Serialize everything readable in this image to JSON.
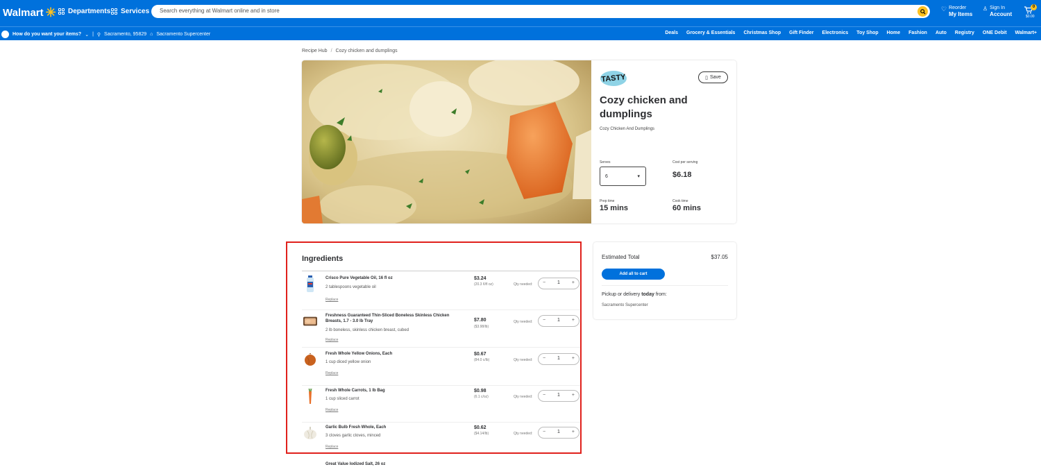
{
  "header": {
    "logo": "Walmart",
    "departments": "Departments",
    "services": "Services",
    "search_placeholder": "Search everything at Walmart online and in store",
    "reorder_top": "Reorder",
    "reorder_bottom": "My Items",
    "signin_top": "Sign In",
    "signin_bottom": "Account",
    "cart_count": "0",
    "cart_amount": "$0.00"
  },
  "subbar": {
    "how": "How do you want your items?",
    "zip": "Sacramento, 95829",
    "store": "Sacramento Supercenter",
    "nav": [
      "Deals",
      "Grocery & Essentials",
      "Christmas Shop",
      "Gift Finder",
      "Electronics",
      "Toy Shop",
      "Home",
      "Fashion",
      "Auto",
      "Registry",
      "ONE Debit",
      "Walmart+"
    ]
  },
  "breadcrumb": {
    "root": "Recipe Hub",
    "current": "Cozy chicken and dumplings"
  },
  "recipe": {
    "brand": "TASTY",
    "save": "Save",
    "title": "Cozy chicken and dumplings",
    "subtitle": "Cozy Chicken And Dumplings",
    "serves_label": "Serves",
    "serves_value": "6",
    "cost_label": "Cost per serving",
    "cost_value": "$6.18",
    "prep_label": "Prep time",
    "prep_value": "15 mins",
    "cook_label": "Cook time",
    "cook_value": "60 mins"
  },
  "ingredients": {
    "title": "Ingredients",
    "qty_label": "Qty needed:",
    "replace": "Replace",
    "items": [
      {
        "name": "Crisco Pure Vegetable Oil, 16 fl oz",
        "desc": "2 tablespoons vegetable oil",
        "price": "$3.24",
        "unit": "(20.3 ¢/fl oz)",
        "qty": "1",
        "icon": "oil-bottle-icon"
      },
      {
        "name": "Freshness Guaranteed Thin-Sliced Boneless Skinless Chicken Breasts, 1.7 - 3.0 lb Tray",
        "desc": "2 lb boneless, skinless chicken breast, cubed",
        "price": "$7.80",
        "unit": "($3.98/lb)",
        "qty": "1",
        "icon": "chicken-tray-icon"
      },
      {
        "name": "Fresh Whole Yellow Onions, Each",
        "desc": "1 cup diced yellow onion",
        "price": "$0.67",
        "unit": "(84.0 c/lb)",
        "qty": "1",
        "icon": "onion-icon"
      },
      {
        "name": "Fresh Whole Carrots, 1 lb Bag",
        "desc": "1 cup sliced carrot",
        "price": "$0.98",
        "unit": "(6.1 c/oz)",
        "qty": "1",
        "icon": "carrot-icon"
      },
      {
        "name": "Garlic Bulb Fresh Whole, Each",
        "desc": "3 cloves garlic cloves, minced",
        "price": "$0.62",
        "unit": "($4.14/lb)",
        "qty": "1",
        "icon": "garlic-icon"
      }
    ],
    "peek_name": "Great Value Iodized Salt, 26 oz"
  },
  "estimate": {
    "label": "Estimated Total",
    "total": "$37.05",
    "add_all": "Add all to cart",
    "pickup_pre": "Pickup or delivery",
    "pickup_bold": "today",
    "pickup_post": "from:",
    "store": "Sacramento Supercenter"
  }
}
